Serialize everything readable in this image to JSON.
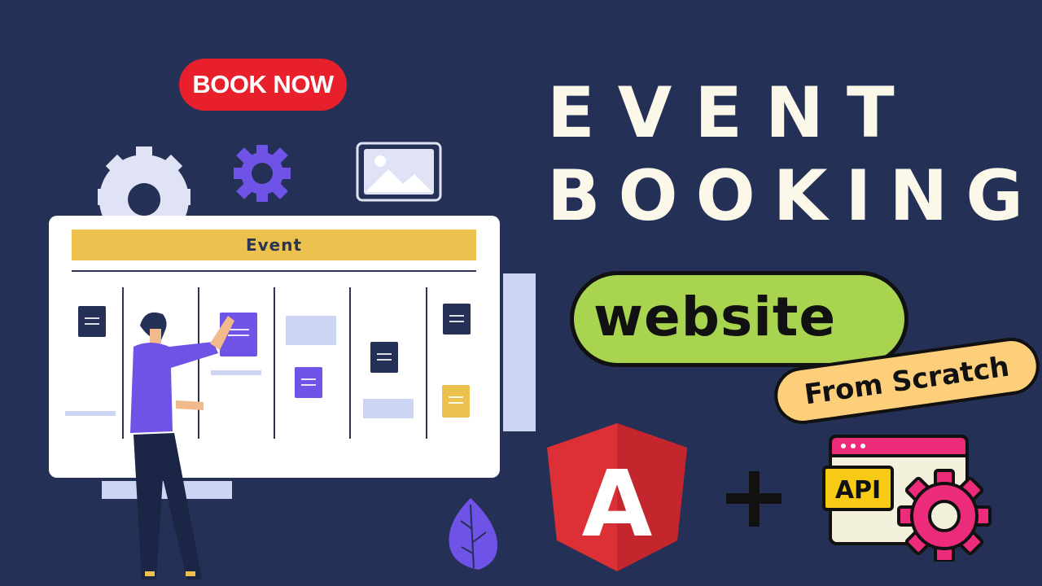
{
  "badge": {
    "book_now": "BOOK NOW"
  },
  "title": {
    "line1": "EVENT",
    "line2": "BOOKING"
  },
  "pill": {
    "website": "website",
    "from_scratch": "From Scratch"
  },
  "board": {
    "header": "Event"
  },
  "icons": {
    "api_label": "API",
    "angular_letter": "A"
  },
  "colors": {
    "background": "#243055",
    "book_now": "#e8202b",
    "website_pill": "#a8d450",
    "scratch_pill": "#fdcf7a",
    "board_header": "#ecc14e",
    "angular_red": "#dd3036",
    "gear_pink": "#ec2b7b",
    "api_yellow": "#f7cb15"
  }
}
